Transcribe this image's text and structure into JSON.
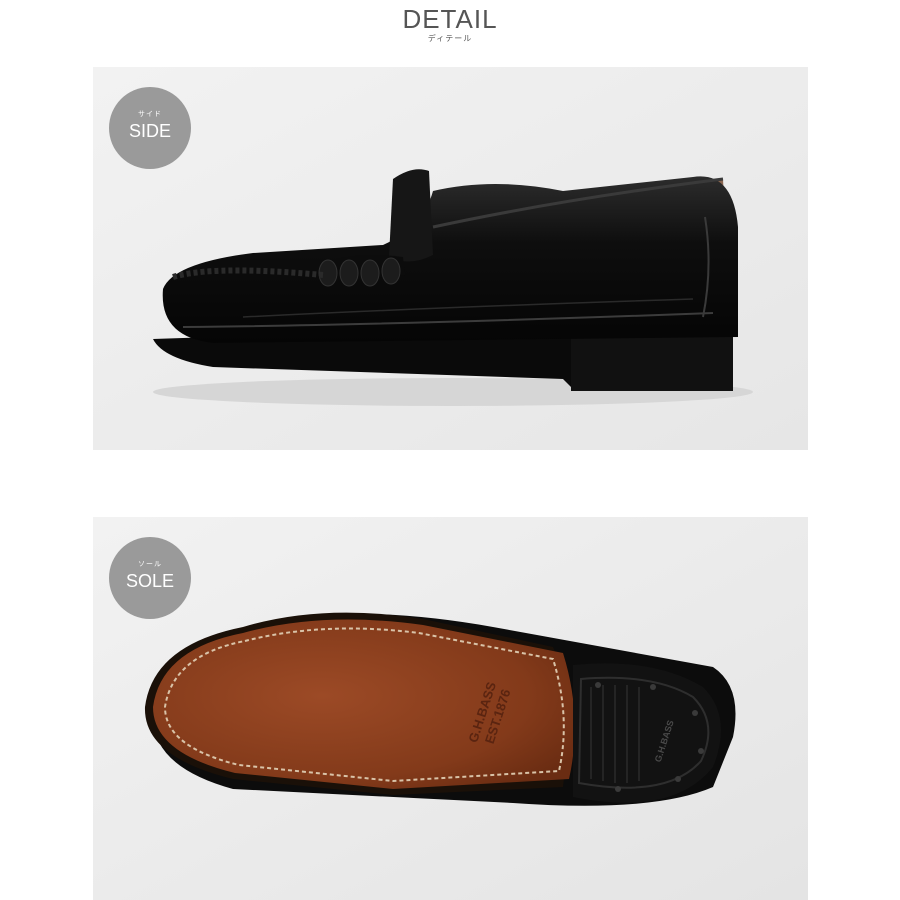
{
  "header": {
    "title": "DETAIL",
    "subtitle": "ディテール"
  },
  "side_panel": {
    "badge_jp": "サイド",
    "badge_en": "SIDE"
  },
  "sole_panel": {
    "badge_jp": "ソール",
    "badge_en": "SOLE",
    "sole_stamp_line1": "G.H.BASS",
    "sole_stamp_line2": "EST.1876",
    "heel_stamp": "G.H.BASS"
  },
  "colors": {
    "badge": "#9a9a9a",
    "leather": "#141414",
    "sole": "#8a3a1c",
    "background": "#eeeeee"
  }
}
